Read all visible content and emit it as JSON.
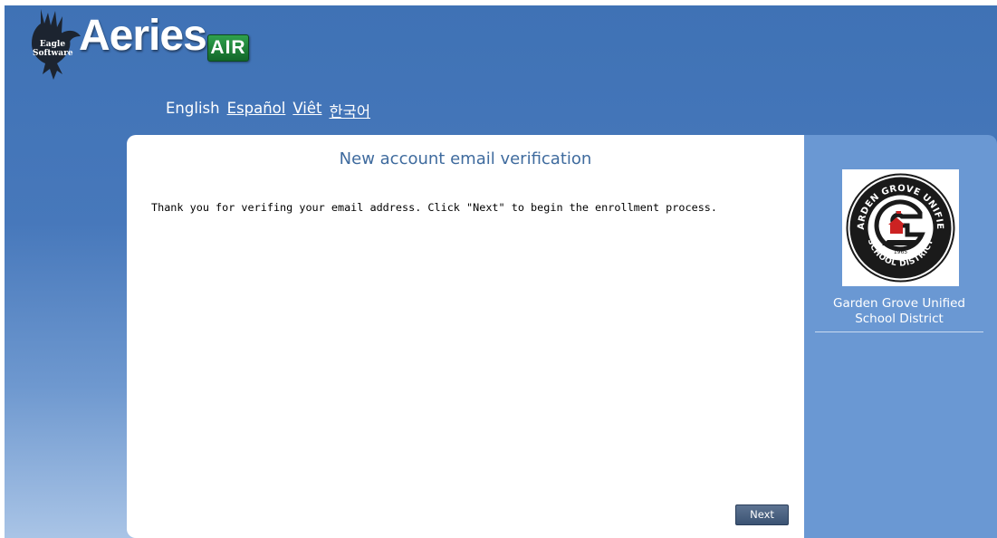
{
  "header": {
    "eagle_text_line1": "Eagle",
    "eagle_text_line2": "Software",
    "brand": "Aeries",
    "badge": "AIR"
  },
  "languages": [
    {
      "label": "English",
      "active": true
    },
    {
      "label": "Español",
      "active": false
    },
    {
      "label": "Viêt",
      "active": false
    },
    {
      "label": "한국어",
      "active": false
    }
  ],
  "main": {
    "title": "New account email verification",
    "message": "Thank you for verifing your email address. Click \"Next\" to begin the enrollment process.",
    "next_label": "Next"
  },
  "district": {
    "name_line1": "Garden Grove Unified",
    "name_line2": "School District",
    "seal_top_text": "GARDEN GROVE UNIFIED",
    "seal_bottom_text": "SCHOOL DISTRICT",
    "seal_year": "1965"
  },
  "colors": {
    "background": "#4778bb",
    "side_panel": "#6a98d3",
    "title": "#3f6b9e",
    "badge_green": "#1f8a3c"
  }
}
